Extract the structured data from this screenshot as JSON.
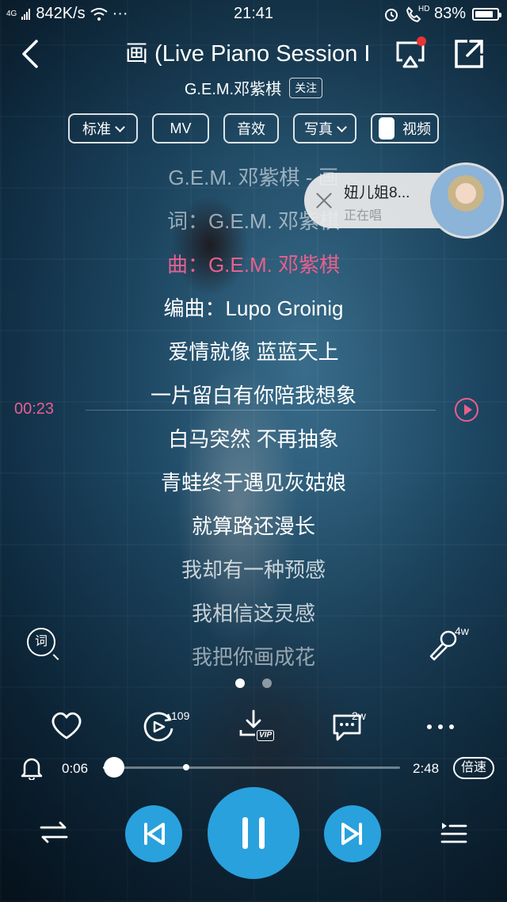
{
  "status_bar": {
    "network": "4G",
    "speed": "842K/s",
    "more": "···",
    "time": "21:41",
    "hd": "HD",
    "battery": "83%",
    "battery_level": 0.83
  },
  "header": {
    "title": "画 (Live Piano Session I",
    "artist": "G.E.M.邓紫棋",
    "follow": "关注"
  },
  "chips": {
    "quality": "标准",
    "mv": "MV",
    "effect": "音效",
    "photo": "写真",
    "video": "视频"
  },
  "lyrics": [
    "G.E.M. 邓紫棋 - 画",
    "词：G.E.M. 邓紫棋",
    "曲：G.E.M. 邓紫棋",
    "编曲：Lupo Groinig",
    "爱情就像 蓝蓝天上",
    "一片留白有你陪我想象",
    "白马突然 不再抽象",
    "青蛙终于遇见灰姑娘",
    "就算路还漫长",
    "我却有一种预感",
    "我相信这灵感",
    "我把你画成花"
  ],
  "seek": {
    "time": "00:23"
  },
  "popup": {
    "name": "妞儿姐8...",
    "status": "正在唱"
  },
  "side": {
    "lyric_icon": "词",
    "mic_count": "4w"
  },
  "actions": {
    "timer_count": "109",
    "vip": "VIP",
    "comment_count": "2w"
  },
  "progress": {
    "current": "0:06",
    "total": "2:48",
    "speed": "倍速",
    "played_fraction": 0.036,
    "mark_fraction": 0.28
  },
  "colors": {
    "accent": "#29a1dd",
    "highlight": "#ea5f8d"
  }
}
